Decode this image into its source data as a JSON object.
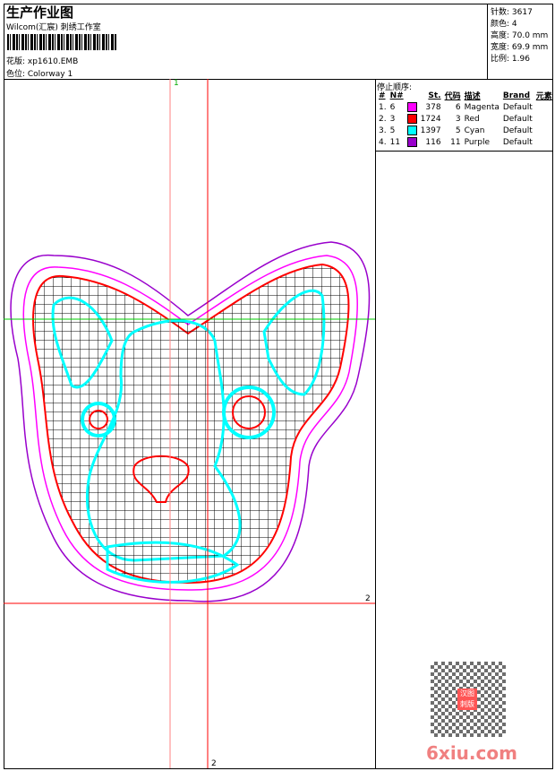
{
  "header": {
    "title": "生产作业图",
    "company": "Wilcom(汇宸) 刺绣工作室",
    "design": "花版: xp1610.EMB",
    "colorway": "色位: Colorway 1"
  },
  "stats": {
    "stitches": "针数: 3617",
    "colors": "颜色: 4",
    "height": "高度: 70.0 mm",
    "width": "宽度: 69.9 mm",
    "scale": "比例: 1.96"
  },
  "stop_sequence": {
    "title": "停止顺序:",
    "columns": [
      "#",
      "N#",
      "",
      "St.",
      "代码",
      "描述",
      "Brand",
      "元素"
    ],
    "rows": [
      {
        "idx": "1.",
        "n": "6",
        "color": "#ff00ff",
        "st": "378",
        "code": "6",
        "desc": "Magenta",
        "brand": "Default"
      },
      {
        "idx": "2.",
        "n": "3",
        "color": "#ff0000",
        "st": "1724",
        "code": "3",
        "desc": "Red",
        "brand": "Default"
      },
      {
        "idx": "3.",
        "n": "5",
        "color": "#00ffff",
        "st": "1397",
        "code": "5",
        "desc": "Cyan",
        "brand": "Default"
      },
      {
        "idx": "4.",
        "n": "11",
        "color": "#9900cc",
        "st": "116",
        "code": "11",
        "desc": "Purple",
        "brand": "Default"
      }
    ]
  },
  "guides": {
    "v1": "1",
    "v2": "2",
    "h2": "2"
  },
  "watermark": {
    "logo": "6xiu.com",
    "seal": "汉图刺版"
  }
}
